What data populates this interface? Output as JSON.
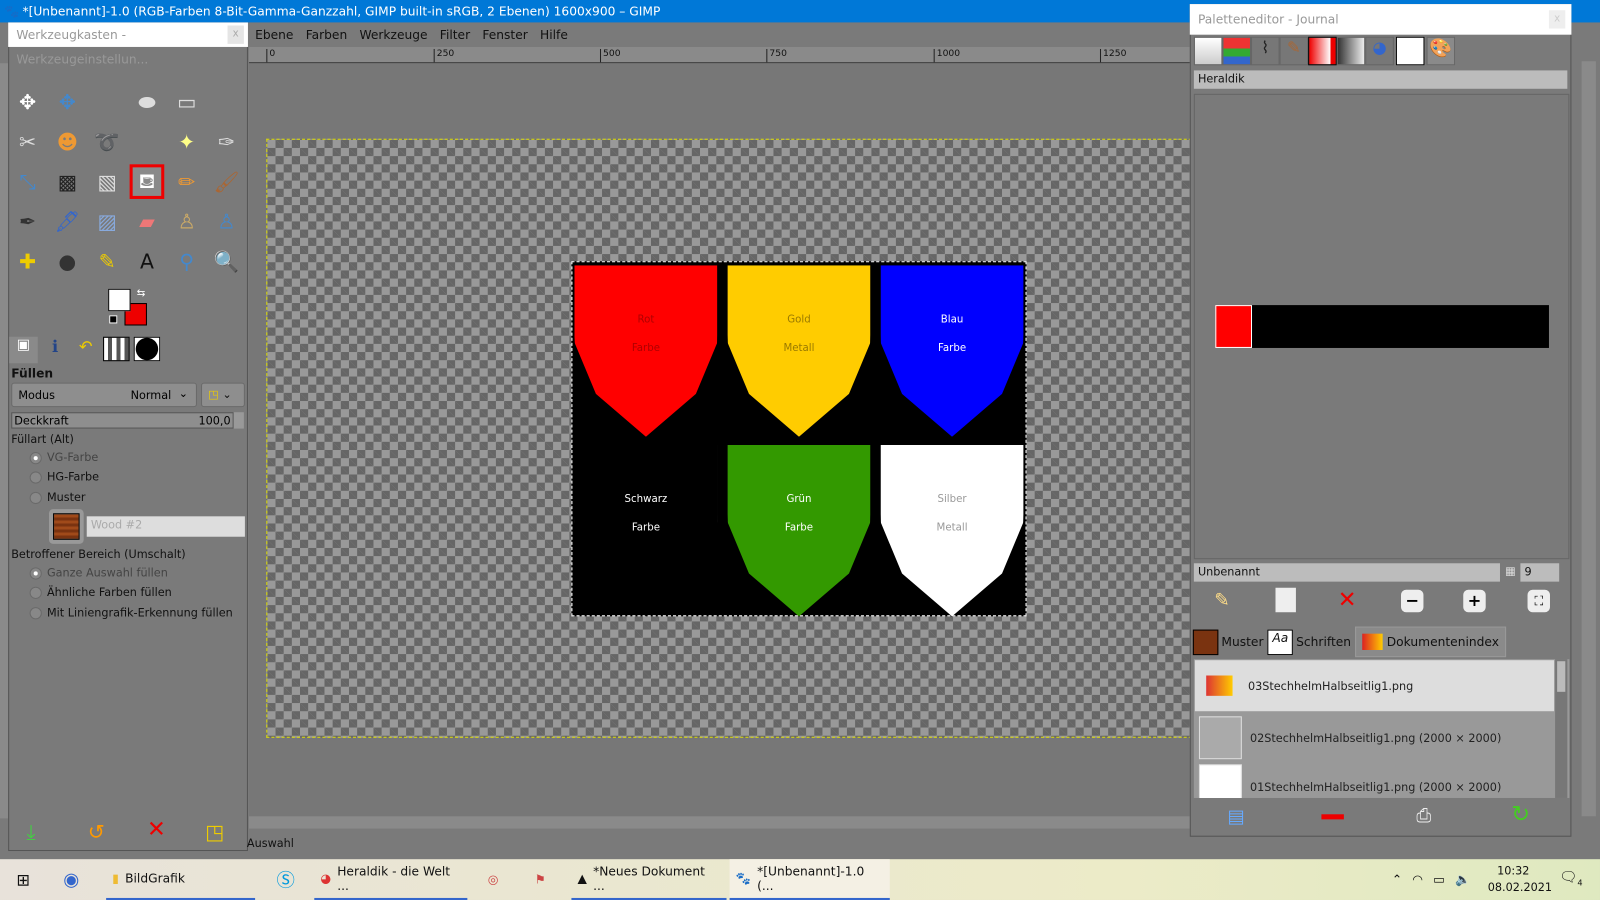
{
  "window": {
    "title": "*[Unbenannt]-1.0 (RGB-Farben 8-Bit-Gamma-Ganzzahl, GIMP built-in sRGB, 2 Ebenen) 1600x900 – GIMP"
  },
  "menu": [
    "Ebene",
    "Farben",
    "Werkzeuge",
    "Filter",
    "Fenster",
    "Hilfe"
  ],
  "ruler": [
    "0",
    "250",
    "500",
    "750",
    "1000",
    "1250"
  ],
  "toolbox": {
    "title": "Werkzeugkasten - Werkzeugeinstellun...",
    "close": "x",
    "section": "Füllen",
    "mode_label": "Modus",
    "mode_value": "Normal",
    "opacity_label": "Deckkraft",
    "opacity_value": "100,0",
    "fill_type_label": "Füllart  (Alt)",
    "fill_types": [
      "VG-Farbe",
      "HG-Farbe",
      "Muster"
    ],
    "pattern_name": "Wood #2",
    "area_label": "Betroffener Bereich (Umschalt)",
    "areas": [
      "Ganze Auswahl füllen",
      "Ähnliche Farben füllen",
      "Mit Liniengrafik-Erkennung füllen"
    ],
    "fg_color": "#ffffff",
    "bg_color": "#ee0000"
  },
  "image": {
    "shields": [
      {
        "name": "Rot",
        "type": "Farbe",
        "color": "#ff0000",
        "text": "#b00000"
      },
      {
        "name": "Gold",
        "type": "Metall",
        "color": "#ffcc00",
        "text": "#9a7a00"
      },
      {
        "name": "Blau",
        "type": "Farbe",
        "color": "#0000ff",
        "text": "#ffffff"
      },
      {
        "name": "Schwarz",
        "type": "Farbe",
        "color": "#000000",
        "text": "#ffffff"
      },
      {
        "name": "Grün",
        "type": "Farbe",
        "color": "#339900",
        "text": "#ffffff"
      },
      {
        "name": "Silber",
        "type": "Metall",
        "color": "#ffffff",
        "text": "#999999"
      }
    ]
  },
  "status": {
    "text": "Auswahl"
  },
  "palette": {
    "title": "Paletteneditor - Journal",
    "name": "Heraldik",
    "entry_name": "Unbenannt",
    "columns": "9",
    "swatches": [
      "#ff0000",
      "#000000"
    ]
  },
  "docs": {
    "tabs": [
      "Muster",
      "Schriften",
      "Dokumentenindex"
    ],
    "items": [
      "03StechhelmHalbseitlig1.png",
      "02StechhelmHalbseitlig1.png (2000 × 2000)",
      "01StechhelmHalbseitlig1.png (2000 × 2000)"
    ]
  },
  "taskbar": {
    "items": [
      "BildGrafik",
      "Heraldik - die Welt ...",
      "*Neues Dokument ...",
      "*[Unbenannt]-1.0 (..."
    ],
    "time": "10:32",
    "date": "08.02.2021",
    "notif": "4"
  }
}
